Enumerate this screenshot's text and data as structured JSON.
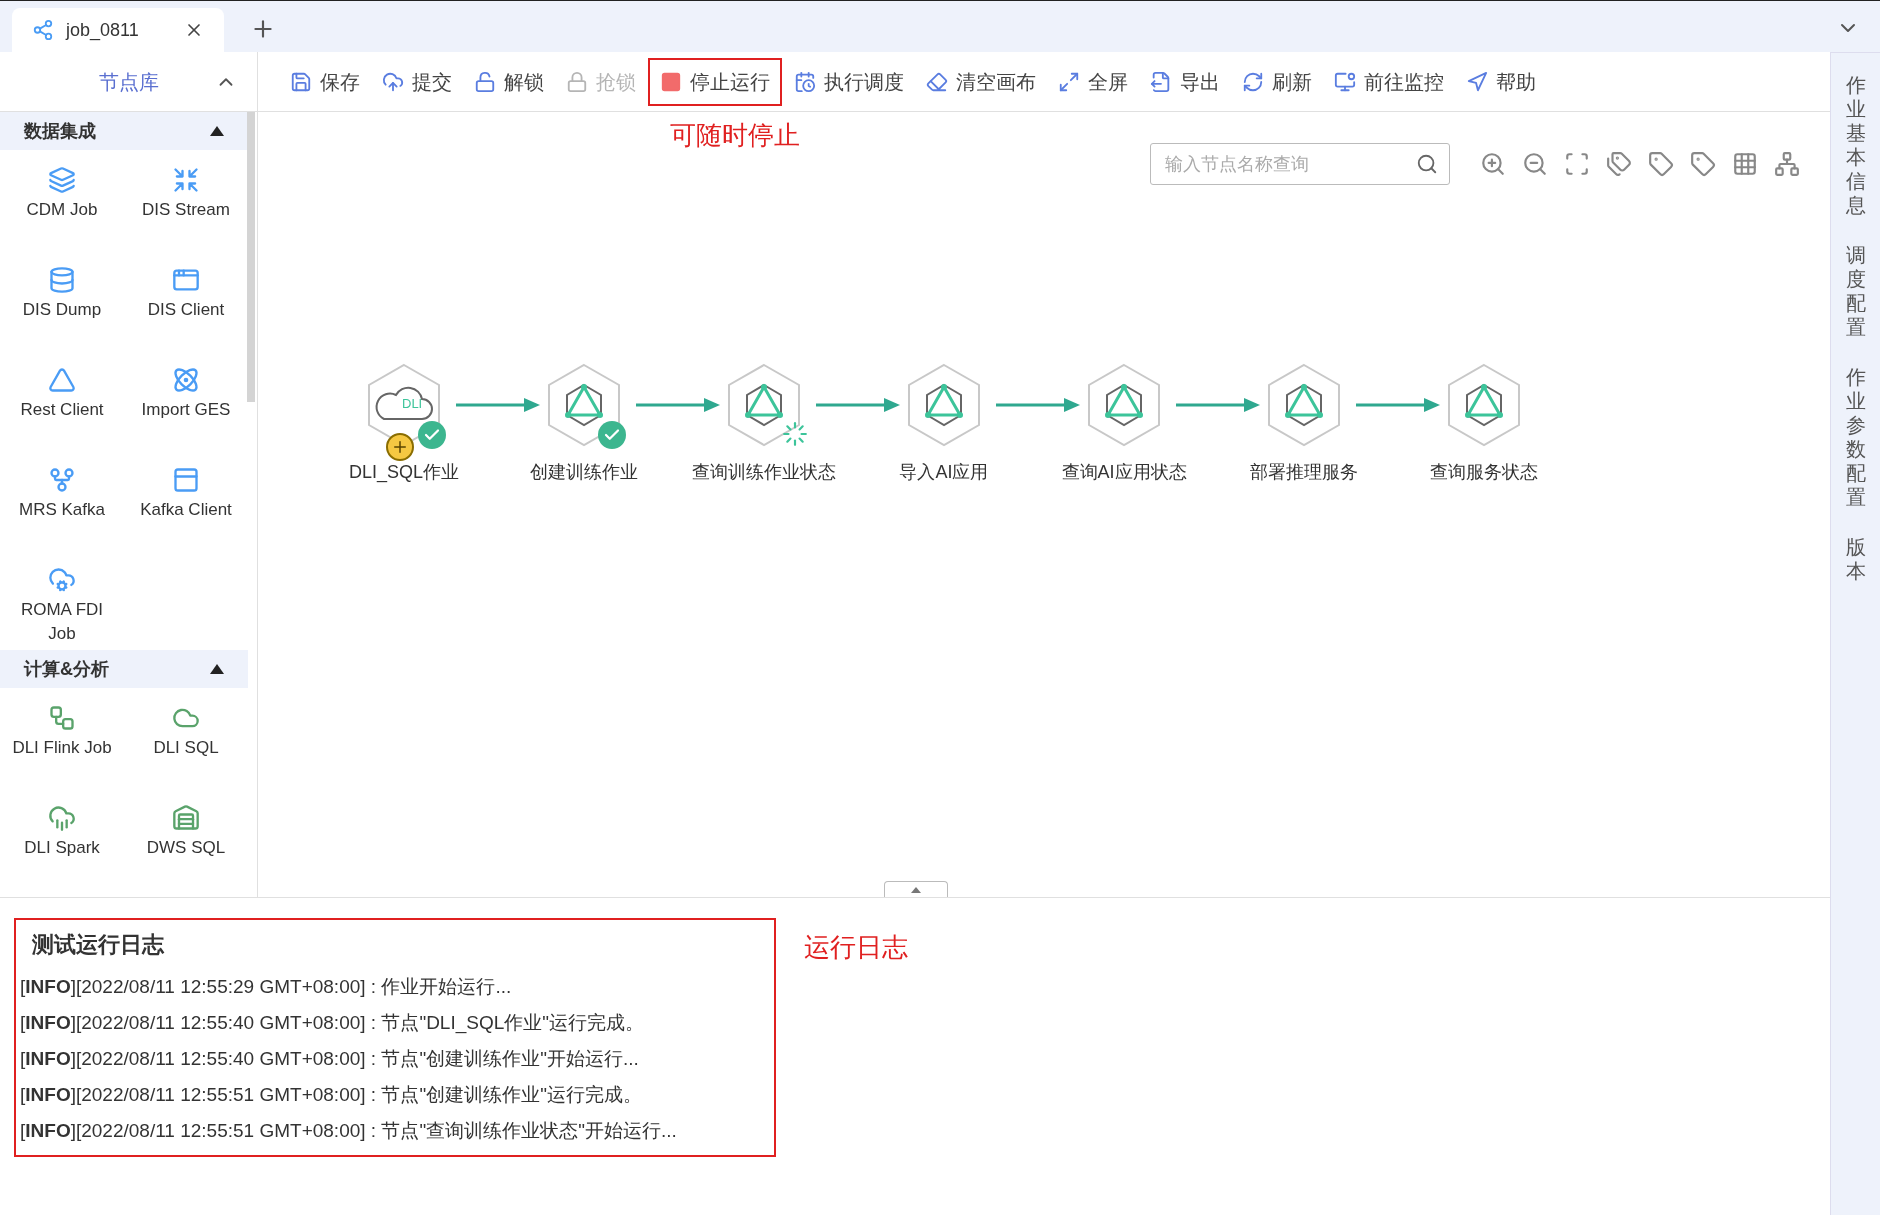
{
  "tabs": [
    {
      "label": "job_0811",
      "selected": true
    }
  ],
  "sidebar": {
    "title": "节点库",
    "groups": [
      {
        "title": "数据集成",
        "expanded": true,
        "items": [
          "CDM Job",
          "DIS Stream",
          "DIS Dump",
          "DIS Client",
          "Rest Client",
          "Import GES",
          "MRS Kafka",
          "Kafka Client",
          "ROMA FDI Job"
        ]
      },
      {
        "title": "计算&分析",
        "expanded": true,
        "items": [
          "DLI Flink Job",
          "DLI SQL",
          "DLI Spark",
          "DWS SQL"
        ]
      }
    ]
  },
  "toolbar": [
    {
      "label": "保存",
      "disabled": false,
      "annotated": false
    },
    {
      "label": "提交",
      "disabled": false,
      "annotated": false
    },
    {
      "label": "解锁",
      "disabled": false,
      "annotated": false
    },
    {
      "label": "抢锁",
      "disabled": true,
      "annotated": false
    },
    {
      "label": "停止运行",
      "disabled": false,
      "annotated": true
    },
    {
      "label": "执行调度",
      "disabled": false,
      "annotated": false
    },
    {
      "label": "清空画布",
      "disabled": false,
      "annotated": false
    },
    {
      "label": "全屏",
      "disabled": false,
      "annotated": false
    },
    {
      "label": "导出",
      "disabled": false,
      "annotated": false
    },
    {
      "label": "刷新",
      "disabled": false,
      "annotated": false
    },
    {
      "label": "前往监控",
      "disabled": false,
      "annotated": false
    },
    {
      "label": "帮助",
      "disabled": false,
      "annotated": false
    }
  ],
  "annotations": [
    "可随时停止",
    "运行日志"
  ],
  "search": {
    "placeholder": "输入节点名称查询"
  },
  "nodes": [
    {
      "label": "DLI_SQL作业",
      "kind": "dli",
      "icon_text": "DLI",
      "succeeded": true,
      "running": false
    },
    {
      "label": "创建训练作业",
      "kind": "ai",
      "succeeded": true,
      "running": false
    },
    {
      "label": "查询训练作业状态",
      "kind": "ai",
      "succeeded": false,
      "running": true
    },
    {
      "label": "导入AI应用",
      "kind": "ai",
      "succeeded": false,
      "running": false
    },
    {
      "label": "查询AI应用状态",
      "kind": "ai",
      "succeeded": false,
      "running": false
    },
    {
      "label": "部署推理服务",
      "kind": "ai",
      "succeeded": false,
      "running": false
    },
    {
      "label": "查询服务状态",
      "kind": "ai",
      "succeeded": false,
      "running": false
    }
  ],
  "log": {
    "title": "测试运行日志",
    "annotated": true,
    "lines": [
      "[**INFO**][2022/08/11 12:55:29 GMT+08:00] : 作业开始运行...",
      "[**INFO**][2022/08/11 12:55:40 GMT+08:00] : 节点\"DLI_SQL作业\"运行完成。",
      "[**INFO**][2022/08/11 12:55:40 GMT+08:00] : 节点\"创建训练作业\"开始运行...",
      "[**INFO**][2022/08/11 12:55:51 GMT+08:00] : 节点\"创建训练作业\"运行完成。",
      "[**INFO**][2022/08/11 12:55:51 GMT+08:00] : 节点\"查询训练作业状态\"开始运行..."
    ]
  },
  "right_panel": [
    "作业基本信息",
    "调度配置",
    "作业参数配置",
    "版本"
  ]
}
